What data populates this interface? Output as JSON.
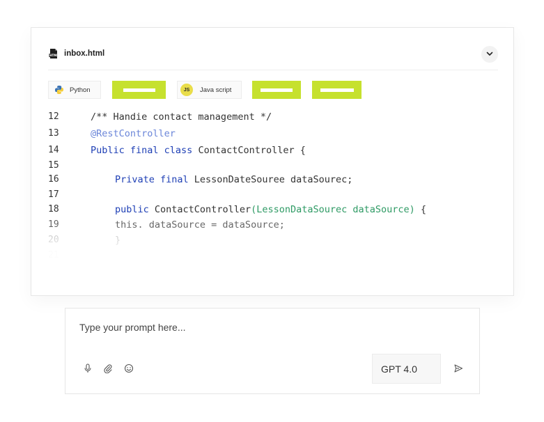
{
  "file": {
    "name": "inbox.html",
    "icon": "html-file-icon"
  },
  "header": {
    "collapse_icon": "chevron-down-icon"
  },
  "tabs": [
    {
      "label": "Python",
      "icon": "python-icon"
    },
    {
      "label": "",
      "placeholder": true
    },
    {
      "label": "Java script",
      "badge": "JS",
      "icon": "javascript-icon"
    },
    {
      "label": "",
      "placeholder": true
    },
    {
      "label": "",
      "placeholder": true
    }
  ],
  "code": {
    "lines": [
      {
        "num": "12",
        "indent": 0,
        "parts": [
          {
            "t": "/** Handie contact management */",
            "c": "plain"
          }
        ]
      },
      {
        "num": "13",
        "indent": 0,
        "parts": [
          {
            "t": "@RestController",
            "c": "ann"
          }
        ]
      },
      {
        "num": "14",
        "indent": 0,
        "parts": [
          {
            "t": "Public final class",
            "c": "kw"
          },
          {
            "t": " ContactController {",
            "c": "plain"
          }
        ]
      },
      {
        "num": "15",
        "indent": 0,
        "parts": []
      },
      {
        "num": "16",
        "indent": 1,
        "parts": [
          {
            "t": "Private final",
            "c": "kw"
          },
          {
            "t": " LessonDateSouree dataSourec;",
            "c": "plain"
          }
        ]
      },
      {
        "num": "17",
        "indent": 0,
        "parts": []
      },
      {
        "num": "18",
        "indent": 1,
        "parts": [
          {
            "t": "public",
            "c": "kw"
          },
          {
            "t": " ContactController",
            "c": "plain"
          },
          {
            "t": "(LessonDataSourec dataSource)",
            "c": "grn"
          },
          {
            "t": " {",
            "c": "plain"
          }
        ]
      },
      {
        "num": "19",
        "indent": 1,
        "parts": [
          {
            "t": "this. dataSource = dataSource;",
            "c": "plain"
          }
        ]
      },
      {
        "num": "20",
        "indent": 1,
        "parts": [
          {
            "t": "}",
            "c": "plain"
          }
        ]
      },
      {
        "num": "21",
        "indent": 0,
        "parts": []
      }
    ]
  },
  "prompt": {
    "placeholder": "Type your prompt here...",
    "tools": [
      "microphone-icon",
      "paperclip-icon",
      "emoji-icon"
    ],
    "model": "GPT 4.0",
    "send_icon": "send-icon"
  },
  "colors": {
    "accent": "#c6e12e",
    "keyword": "#1e3fb5",
    "annotation": "#6b86d9",
    "param": "#2e9a64"
  }
}
